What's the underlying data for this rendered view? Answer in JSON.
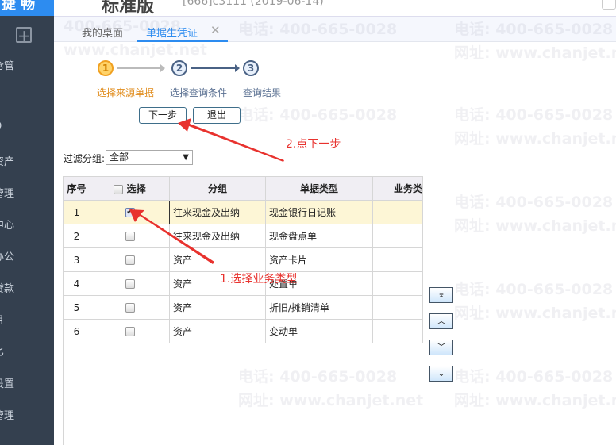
{
  "header": {
    "logo": "捷 畅",
    "title": "标准版",
    "subtitle": "[666]c3111  (2019-06-14)"
  },
  "sidebar": {
    "items": [
      "仓管",
      "O",
      "资产",
      "管理",
      "中心",
      "办公",
      "贷款",
      "月",
      "匕",
      "设置",
      "管理"
    ]
  },
  "tabs": [
    {
      "label": "我的桌面",
      "active": false
    },
    {
      "label": "单据生凭证",
      "active": true
    }
  ],
  "wizard": {
    "steps": [
      {
        "num": "1",
        "label": "选择来源单据",
        "current": true
      },
      {
        "num": "2",
        "label": "选择查询条件",
        "current": false
      },
      {
        "num": "3",
        "label": "查询结果",
        "current": false
      }
    ]
  },
  "buttons": {
    "next": "下一步",
    "exit": "退出"
  },
  "filter": {
    "label": "过滤分组:",
    "value": "全部"
  },
  "table": {
    "headers": [
      "序号",
      "选择",
      "分组",
      "单据类型",
      "业务类"
    ],
    "rows": [
      {
        "no": "1",
        "checked": true,
        "group": "往来现金及出纳",
        "type": "现金银行日记账"
      },
      {
        "no": "2",
        "checked": false,
        "group": "往来现金及出纳",
        "type": "现金盘点单"
      },
      {
        "no": "3",
        "checked": false,
        "group": "资产",
        "type": "资产卡片"
      },
      {
        "no": "4",
        "checked": false,
        "group": "资产",
        "type": "处置单"
      },
      {
        "no": "5",
        "checked": false,
        "group": "资产",
        "type": "折旧/摊销清单"
      },
      {
        "no": "6",
        "checked": false,
        "group": "资产",
        "type": "变动单"
      }
    ]
  },
  "nav_buttons": {
    "top": "⌅",
    "up": "︿",
    "down": "﹀",
    "bottom": "⌄"
  },
  "annotations": {
    "step1": "1.选择业务类型",
    "step2": "2.点下一步"
  },
  "watermark": {
    "phone": "电话: 400-665-0028",
    "url": "网址: www.chanjet.net"
  },
  "colors": {
    "accent": "#2d8cf0",
    "sidebar": "#34404f",
    "annotation": "#e8322e",
    "current_step": "#f0a020"
  }
}
